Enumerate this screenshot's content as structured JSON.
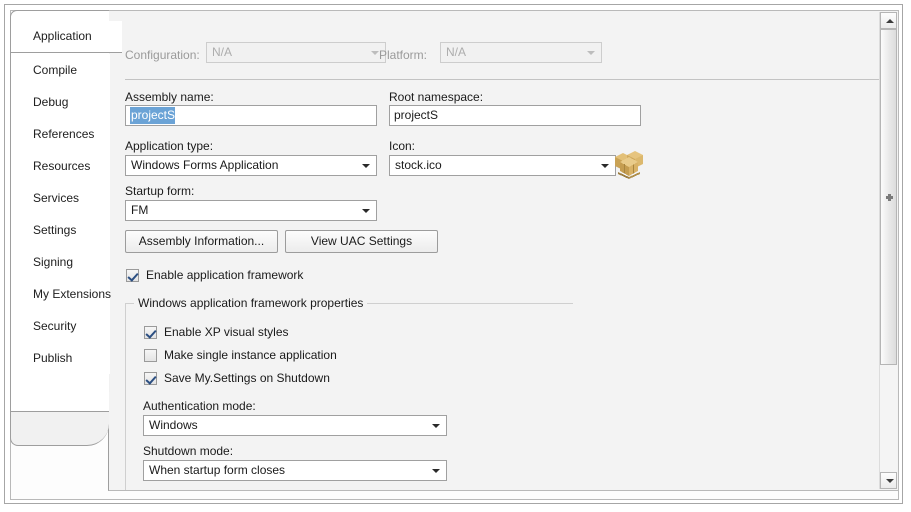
{
  "tabs": [
    {
      "label": "Application",
      "selected": true
    },
    {
      "label": "Compile",
      "selected": false
    },
    {
      "label": "Debug",
      "selected": false
    },
    {
      "label": "References",
      "selected": false
    },
    {
      "label": "Resources",
      "selected": false
    },
    {
      "label": "Services",
      "selected": false
    },
    {
      "label": "Settings",
      "selected": false
    },
    {
      "label": "Signing",
      "selected": false
    },
    {
      "label": "My Extensions",
      "selected": false
    },
    {
      "label": "Security",
      "selected": false
    },
    {
      "label": "Publish",
      "selected": false
    }
  ],
  "top_bar": {
    "configuration_label": "Configuration:",
    "configuration_value": "N/A",
    "platform_label": "Platform:",
    "platform_value": "N/A"
  },
  "application": {
    "assembly_name_label": "Assembly name:",
    "assembly_name_value": "projectS",
    "root_namespace_label": "Root namespace:",
    "root_namespace_value": "projectS",
    "application_type_label": "Application type:",
    "application_type_value": "Windows Forms Application",
    "icon_label": "Icon:",
    "icon_value": "stock.ico",
    "startup_form_label": "Startup form:",
    "startup_form_value": "FM",
    "assembly_information_button": "Assembly Information...",
    "view_uac_button": "View UAC Settings",
    "enable_framework_label": "Enable application framework",
    "enable_framework_checked": true
  },
  "framework_group": {
    "title": "Windows application framework properties",
    "checkboxes": [
      {
        "label": "Enable XP visual styles",
        "checked": true
      },
      {
        "label": "Make single instance application",
        "checked": false
      },
      {
        "label": "Save My.Settings on Shutdown",
        "checked": true
      }
    ],
    "authentication_mode_label": "Authentication mode:",
    "authentication_mode_value": "Windows",
    "shutdown_mode_label": "Shutdown mode:",
    "shutdown_mode_value": "When startup form closes"
  },
  "colors": {
    "selection_blue": "#6ba3d6",
    "pane_background": "#f3f3f3",
    "checkmark": "#2c4f82",
    "icon_gold": "#d7b368"
  }
}
